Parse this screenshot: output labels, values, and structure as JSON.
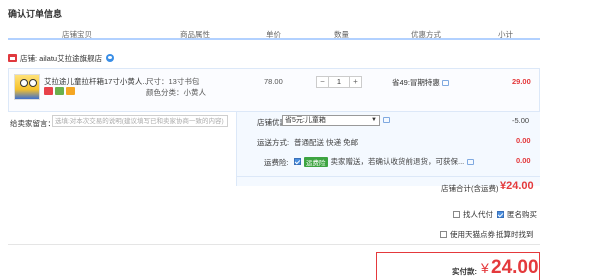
{
  "page_title": "确认订单信息",
  "columns": [
    "店铺宝贝",
    "商品属性",
    "单价",
    "数量",
    "优惠方式",
    "小计"
  ],
  "shop": {
    "label": "店铺: ailatu艾拉途旗舰店"
  },
  "item": {
    "title": "艾拉途儿童拉杆箱17寸小黄人...",
    "size": "尺寸：13寸书包",
    "color": "颜色分类：小黄人",
    "unit_price": "78.00",
    "qty_minus": "−",
    "quantity": "1",
    "qty_plus": "+",
    "promo": "省49:冒期特惠",
    "subtotal": "29.00",
    "badge_colors": [
      "#e8424a",
      "#6ab04c",
      "#f5a623"
    ]
  },
  "message": {
    "label": "给卖家留言：",
    "placeholder": "选填:对本次交易的说明(建议填写已和卖家协商一致的内容)"
  },
  "options": {
    "store_promo_label": "店铺优惠:",
    "store_promo_value": "省5元:儿童箱",
    "store_promo_amount": "-5.00",
    "shipping_label": "运送方式:",
    "shipping_value": "普通配送 快递 免邮",
    "shipping_amount": "0.00",
    "insurance_label": "运费险:",
    "insurance_badge": "运费险",
    "insurance_text": "卖家赠送，若确认收货前退货，可获保...",
    "insurance_amount": "0.00"
  },
  "store_total": {
    "label": "店铺合计(含运费)",
    "value": "¥24.00"
  },
  "checks": {
    "proxy_pay": "找人代付",
    "anonymous": "匿名购买",
    "tmall_points": "使用天猫点券",
    "no_points": "抵算时找到"
  },
  "payment": {
    "label": "实付款:",
    "currency": "¥",
    "value": "24.00"
  },
  "colors": {
    "accent_red": "#e4393c",
    "header_border": "#b2d1ff",
    "panel_bg": "#f4f9ff"
  }
}
